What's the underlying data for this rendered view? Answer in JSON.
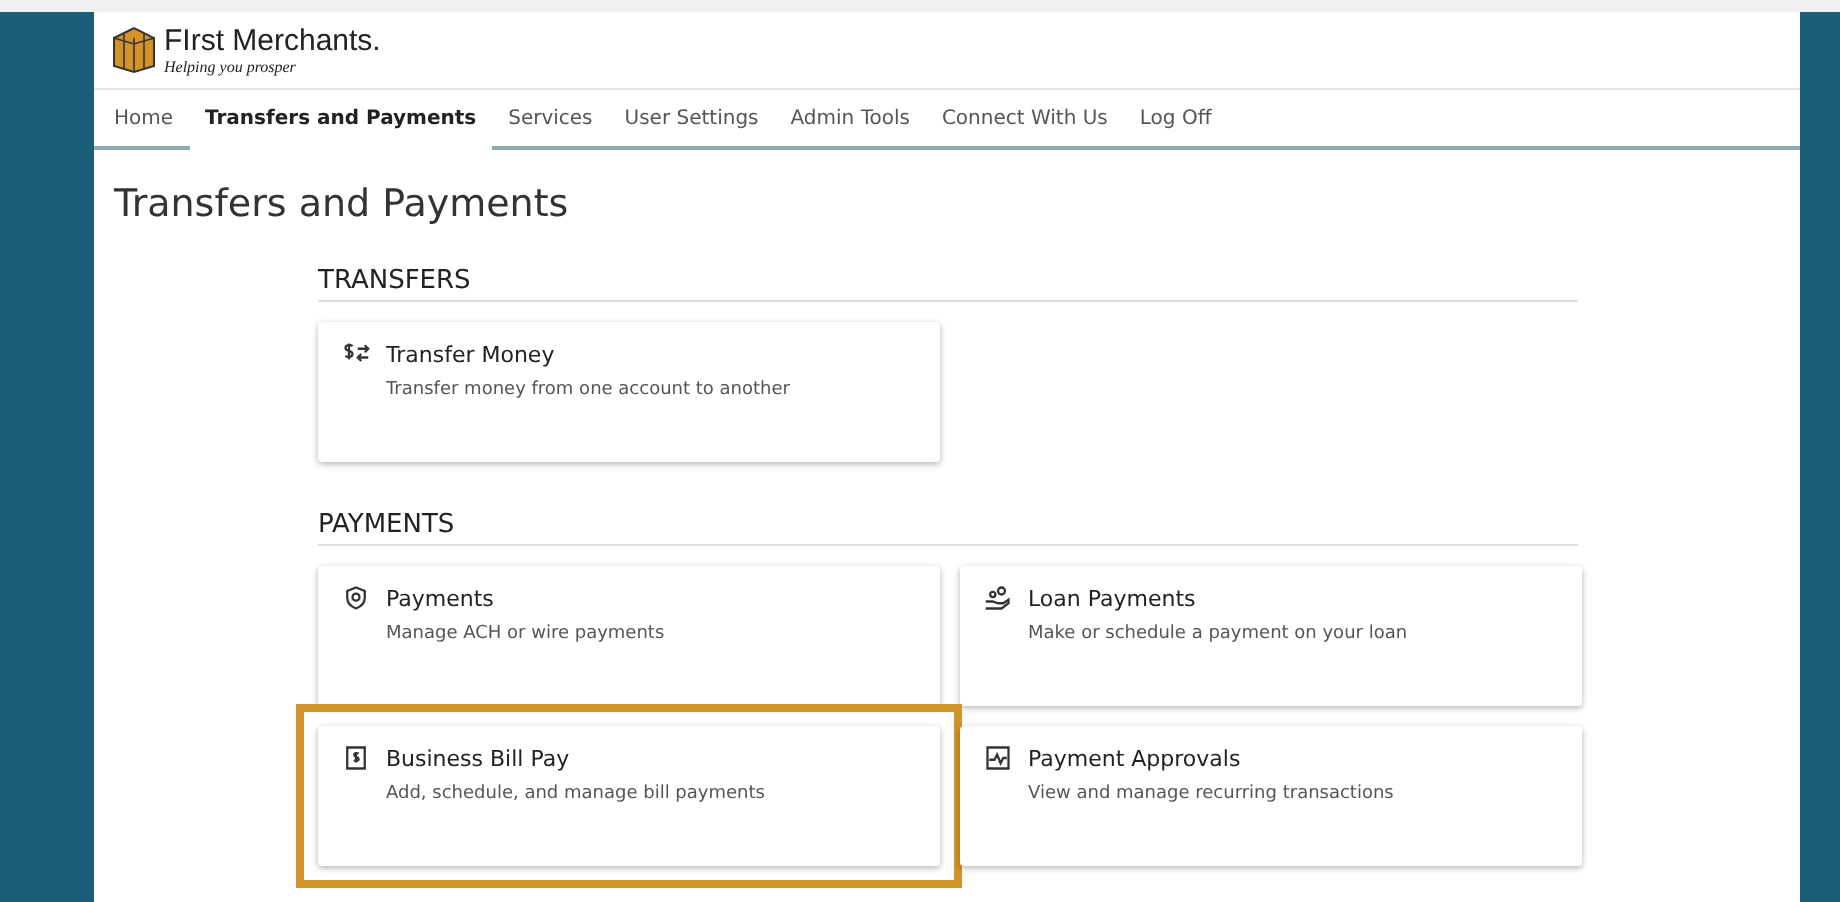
{
  "logo": {
    "name": "FIrst Merchants.",
    "tagline": "Helping you prosper"
  },
  "nav": [
    {
      "label": "Home",
      "selected": false
    },
    {
      "label": "Transfers and Payments",
      "selected": true
    },
    {
      "label": "Services",
      "selected": false
    },
    {
      "label": "User Settings",
      "selected": false
    },
    {
      "label": "Admin Tools",
      "selected": false
    },
    {
      "label": "Connect With Us",
      "selected": false
    },
    {
      "label": "Log Off",
      "selected": false
    }
  ],
  "page_title": "Transfers and Payments",
  "sections": [
    {
      "heading": "TRANSFERS",
      "cards": [
        {
          "kind": "transfer",
          "title": "Transfer Money",
          "description": "Transfer money from one account to another",
          "highlighted": false
        }
      ]
    },
    {
      "heading": "PAYMENTS",
      "cards": [
        {
          "kind": "payments",
          "title": "Payments",
          "description": "Manage ACH or wire payments",
          "highlighted": false
        },
        {
          "kind": "loan",
          "title": "Loan Payments",
          "description": "Make or schedule a payment on your loan",
          "highlighted": false
        },
        {
          "kind": "bill",
          "title": "Business Bill Pay",
          "description": "Add, schedule, and manage bill payments",
          "highlighted": true
        },
        {
          "kind": "approvals",
          "title": "Payment Approvals",
          "description": "View and manage recurring transactions",
          "highlighted": false
        }
      ]
    }
  ]
}
